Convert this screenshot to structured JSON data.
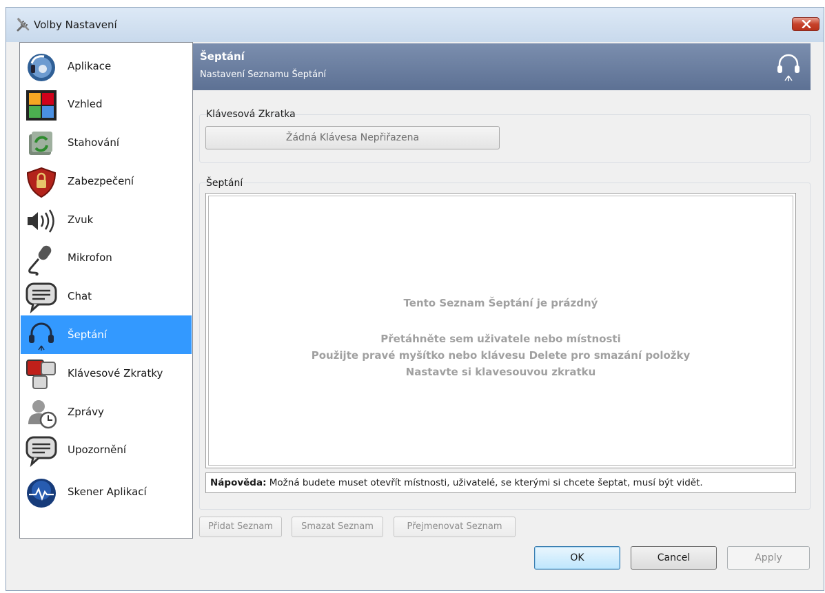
{
  "window": {
    "title": "Volby Nastavení"
  },
  "sidebar": {
    "items": [
      {
        "label": "Aplikace",
        "icon": "teamspeak-icon"
      },
      {
        "label": "Vzhled",
        "icon": "appearance-tiles-icon"
      },
      {
        "label": "Stahování",
        "icon": "download-icon"
      },
      {
        "label": "Zabezpečení",
        "icon": "security-shield-icon"
      },
      {
        "label": "Zvuk",
        "icon": "speaker-icon"
      },
      {
        "label": "Mikrofon",
        "icon": "microphone-icon"
      },
      {
        "label": "Chat",
        "icon": "chat-bubble-icon"
      },
      {
        "label": "Šeptání",
        "icon": "headset-icon",
        "selected": true
      },
      {
        "label": "Klávesové Zkratky",
        "icon": "keyboard-keys-icon"
      },
      {
        "label": "Zprávy",
        "icon": "messages-clock-icon"
      },
      {
        "label": "Upozornění",
        "icon": "notification-bubble-icon"
      },
      {
        "label": "Skener Aplikací",
        "icon": "app-scanner-icon"
      }
    ]
  },
  "header": {
    "title": "Šeptání",
    "subtitle": "Nastavení Seznamu Šeptání"
  },
  "hotkey_group": {
    "title": "Klávesová Zkratka",
    "button_label": "Žádná Klávesa Nepřiřazena"
  },
  "whisper_group": {
    "title": "Šeptání",
    "empty_title": "Tento Seznam Šeptání je prázdný",
    "empty_lines": [
      "Přetáhněte sem uživatele nebo místnosti",
      "Použijte pravé myšítko nebo klávesu Delete pro smazání položky",
      "Nastavte si klavesouvou zkratku"
    ],
    "hint_label": "Nápověda:",
    "hint_text": " Možná budete muset otevřít místnosti, uživatelé, se kterými si chcete šeptat, musí být vidět."
  },
  "list_buttons": {
    "add": "Přidat Seznam",
    "delete": "Smazat Seznam",
    "rename": "Přejmenovat Seznam"
  },
  "dialog_buttons": {
    "ok": "OK",
    "cancel": "Cancel",
    "apply": "Apply"
  },
  "colors": {
    "selection": "#3399ff",
    "header_bg": "#6a7da0"
  }
}
